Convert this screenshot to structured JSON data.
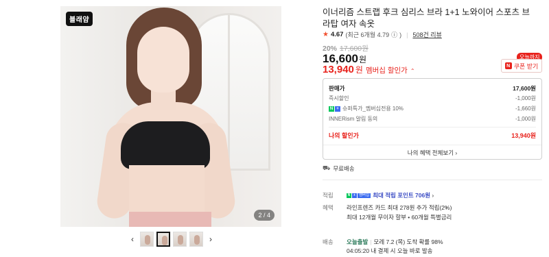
{
  "gallery": {
    "brand_badge": "블래얌",
    "page_indicator": "2 / 4",
    "thumb_prev": "‹",
    "thumb_next": "›",
    "thumbnail_count": 4,
    "active_thumbnail": 2
  },
  "product": {
    "title": "이너리즘 스트랩 후크 심리스 브라 1+1 노와이어 스포츠 브라탑 여자 속옷",
    "rating": "4.67",
    "rating_note": "(최근 6개월 4.79",
    "rating_info_icon": "ⓘ",
    "rating_close": ")",
    "review_count": "508건 리뷰",
    "discount_pct": "20%",
    "original_price": "17,600원",
    "price": "16,600",
    "price_unit": "원",
    "member_price": "13,940",
    "member_unit": "원",
    "member_label": "멤버십 할인가"
  },
  "coupon": {
    "tag": "오늘까지",
    "icon": "N",
    "label": "쿠폰 받기"
  },
  "breakdown": {
    "rows": [
      {
        "label": "판매가",
        "value": "17,600원"
      },
      {
        "label": "즉시할인",
        "value": "-1,000원"
      },
      {
        "label": "슈퍼특가_멤버십전용 10%",
        "value": "-1,660원"
      },
      {
        "label": "INNERism 알림 동의",
        "value": "-1,000원"
      }
    ],
    "mine_label": "나의 할인가",
    "mine_value": "13,940원",
    "more_button": "나의 혜택 전체보기 ›"
  },
  "shipping": {
    "free_label": "무료배송"
  },
  "details": {
    "point_label": "적립",
    "point_text": "최대 적립 포인트 706원",
    "point_chevron": "›",
    "benefit_label": "혜택",
    "benefit_line1": "라인프렌즈 카드 최대 278원 추가 적립(2%)",
    "benefit_chevron": "›",
    "benefit_line2": "최대 12개월 무이자 할부 • 60개월 특별금리",
    "delivery_label": "배송",
    "delivery_tag": "오늘출발",
    "delivery_text": "모레 7.2 (목) 도착 확률 98%",
    "delivery_line2": "04:05:20 내 결제 시 오늘 바로 발송"
  },
  "colors": {
    "accent_red": "#e8221c",
    "naver_green": "#03c75a",
    "point_blue": "#3b4cc4"
  }
}
